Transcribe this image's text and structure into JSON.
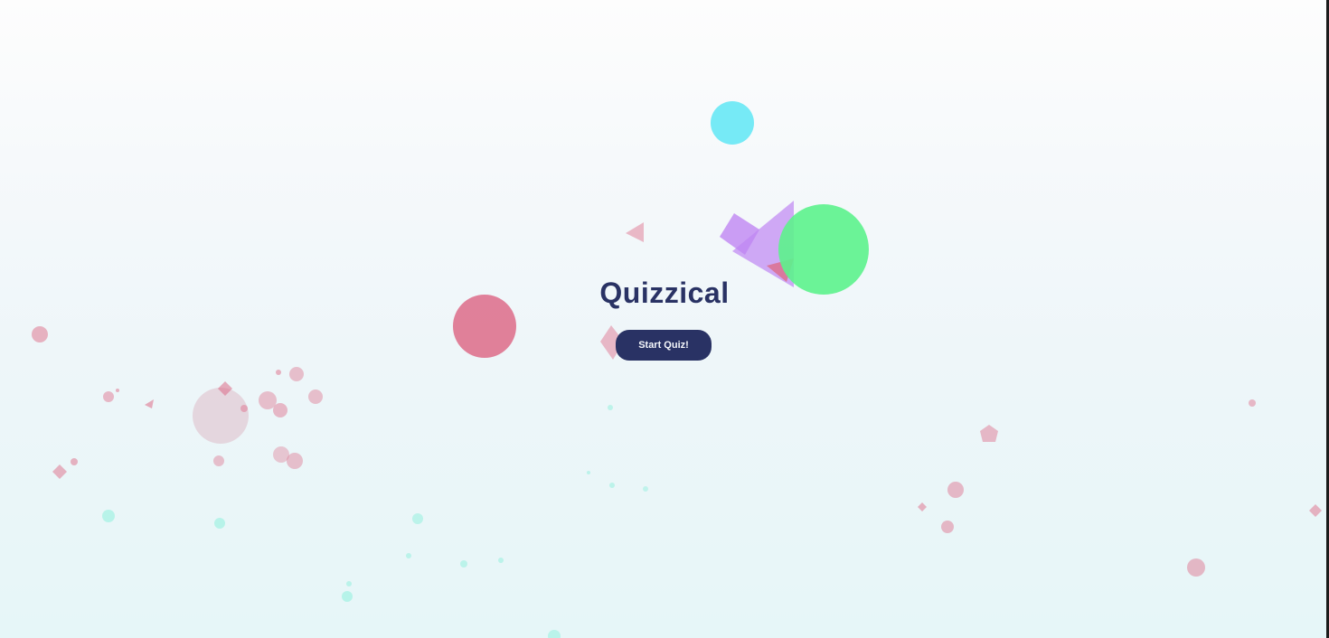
{
  "app": {
    "title": "Quizzical",
    "start_button_label": "Start Quiz!"
  },
  "colors": {
    "title_text": "#293264",
    "button_background": "#293264",
    "button_text": "#f5f7fb",
    "confetti_pink": "#dd6b88",
    "confetti_cyan": "#5fe6f5",
    "confetti_green": "#5cf28c",
    "confetti_purple": "#bf86f2",
    "confetti_mint": "#8ef0dc"
  }
}
